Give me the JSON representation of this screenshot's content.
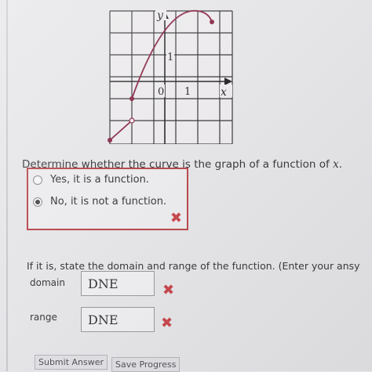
{
  "graph": {
    "y_axis_label": "y",
    "x_axis_label": "x",
    "tick_one_y": "1",
    "tick_zero": "0",
    "tick_one_x": "1"
  },
  "question": {
    "text_prefix": "Determine whether the curve is the graph of a function of ",
    "text_var": "x",
    "text_suffix": "."
  },
  "options": [
    {
      "label": "Yes, it is a function.",
      "selected": false
    },
    {
      "label": "No, it is not a function.",
      "selected": true
    }
  ],
  "prompt2": "If it is, state the domain and range of the function. (Enter your ansy",
  "domain": {
    "label": "domain",
    "value": "DNE"
  },
  "range": {
    "label": "range",
    "value": "DNE"
  },
  "marks": {
    "incorrect": "✖"
  },
  "buttons": {
    "submit": "Submit Answer",
    "save": "Save Progress"
  },
  "colors": {
    "curve": "#8b2c4a",
    "incorrect": "#c8484e",
    "box_border": "#b84b4e"
  }
}
